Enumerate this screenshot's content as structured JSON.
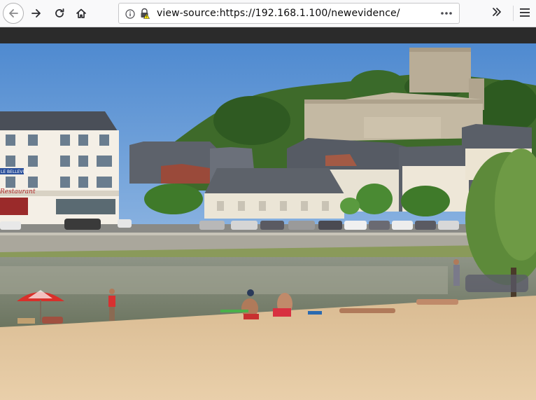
{
  "browser": {
    "url": "view-source:https://192.168.1.100/newevidence/",
    "icons": {
      "back": "back-arrow-icon",
      "forward": "forward-arrow-icon",
      "reload": "reload-icon",
      "home": "home-icon",
      "info": "info-icon",
      "insecure_lock": "warning-lock-icon",
      "page_actions": "ellipsis-icon",
      "overflow": "double-chevron-icon",
      "menu": "hamburger-icon"
    }
  },
  "photo": {
    "sign_hotel": "LE BELLEVUE",
    "sign_restaurant": "Restaurant"
  },
  "colors": {
    "toolbar_bg": "#f9f9fa",
    "dark_band": "#2b2b2b",
    "sky": "#6f9fd8",
    "sand": "#e2c7a0",
    "river": "#7f8a6f"
  }
}
